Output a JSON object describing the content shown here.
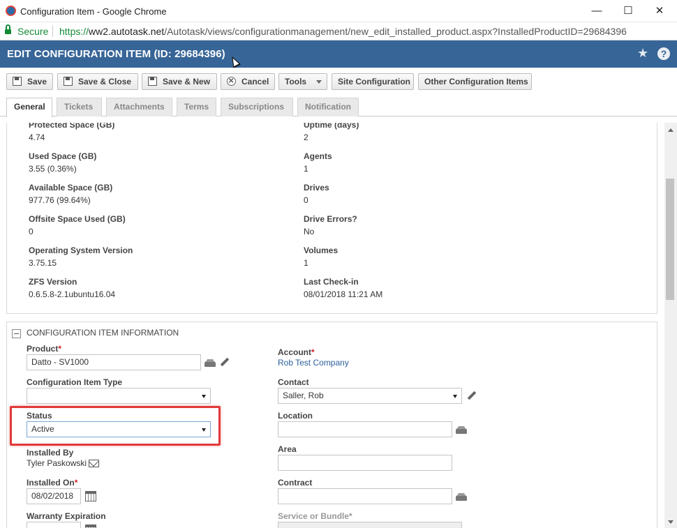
{
  "window": {
    "title": "Configuration Item - Google Chrome",
    "minimize": "—",
    "maximize": "☐",
    "close": "✕"
  },
  "address": {
    "secure_label": "Secure",
    "url_scheme": "https://",
    "url_host": "ww2.autotask.net",
    "url_path": "/Autotask/views/configurationmanagement/new_edit_installed_product.aspx?InstalledProductID=29684396"
  },
  "header": {
    "title": "EDIT CONFIGURATION ITEM (ID: 29684396)",
    "star": "★",
    "help": "?"
  },
  "toolbar": {
    "save": "Save",
    "save_close": "Save & Close",
    "save_new": "Save & New",
    "cancel": "Cancel",
    "tools": "Tools",
    "site_configuration": "Site Configuration",
    "other_items": "Other Configuration Items"
  },
  "tabs": [
    "General",
    "Tickets",
    "Attachments",
    "Terms",
    "Subscriptions",
    "Notification"
  ],
  "backup_info": {
    "left": [
      {
        "label": "Protected Space (GB)",
        "value": "4.74"
      },
      {
        "label": "Used Space (GB)",
        "value": "3.55 (0.36%)"
      },
      {
        "label": "Available Space (GB)",
        "value": "977.76 (99.64%)"
      },
      {
        "label": "Offsite Space Used (GB)",
        "value": "0"
      },
      {
        "label": "Operating System Version",
        "value": "3.75.15"
      },
      {
        "label": "ZFS Version",
        "value": "0.6.5.8-2.1ubuntu16.04"
      }
    ],
    "right": [
      {
        "label": "Uptime (days)",
        "value": "2"
      },
      {
        "label": "Agents",
        "value": "1"
      },
      {
        "label": "Drives",
        "value": "0"
      },
      {
        "label": "Drive Errors?",
        "value": "No"
      },
      {
        "label": "Volumes",
        "value": "1"
      },
      {
        "label": "Last Check-in",
        "value": "08/01/2018 11:21 AM"
      }
    ]
  },
  "ci_section": {
    "title": "CONFIGURATION ITEM INFORMATION",
    "product_label": "Product",
    "product_value": "Datto - SV1000",
    "type_label": "Configuration Item Type",
    "type_value": "",
    "status_label": "Status",
    "status_value": "Active",
    "installed_by_label": "Installed By",
    "installed_by_value": "Tyler Paskowski",
    "installed_on_label": "Installed On",
    "installed_on_value": "08/02/2018",
    "warranty_label": "Warranty Expiration",
    "account_label": "Account",
    "account_value": "Rob Test Company",
    "contact_label": "Contact",
    "contact_value": "Saller, Rob",
    "location_label": "Location",
    "area_label": "Area",
    "contract_label": "Contract",
    "service_label": "Service or Bundle",
    "required_mark": "*"
  }
}
